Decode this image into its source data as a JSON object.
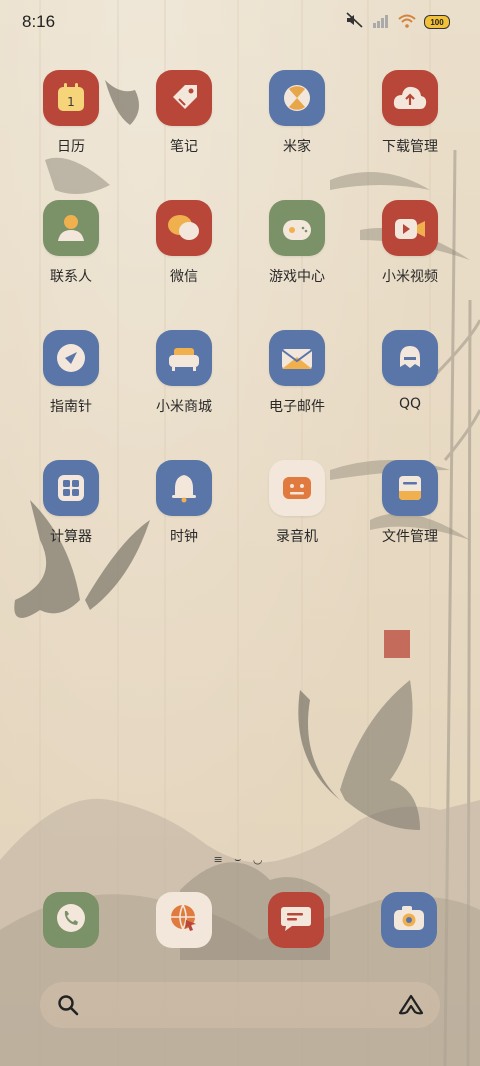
{
  "status_bar": {
    "time": "8:16",
    "battery_level": "100"
  },
  "apps": [
    {
      "label": "日历",
      "icon": "calendar-icon",
      "color": "#b8473a",
      "badge": "1"
    },
    {
      "label": "笔记",
      "icon": "tag-icon",
      "color": "#b8473a"
    },
    {
      "label": "米家",
      "icon": "mijia-icon",
      "color": "#5a76a8"
    },
    {
      "label": "下载管理",
      "icon": "cloud-upload-icon",
      "color": "#b8473a"
    },
    {
      "label": "联系人",
      "icon": "contact-icon",
      "color": "#7b9168"
    },
    {
      "label": "微信",
      "icon": "chat-bubble-icon",
      "color": "#b8473a"
    },
    {
      "label": "游戏中心",
      "icon": "gamepad-icon",
      "color": "#7b9168"
    },
    {
      "label": "小米视频",
      "icon": "video-camera-icon",
      "color": "#b8473a"
    },
    {
      "label": "指南针",
      "icon": "compass-icon",
      "color": "#5a76a8"
    },
    {
      "label": "小米商城",
      "icon": "sofa-icon",
      "color": "#5a76a8"
    },
    {
      "label": "电子邮件",
      "icon": "mail-icon",
      "color": "#5a76a8"
    },
    {
      "label": "QQ",
      "icon": "penguin-icon",
      "color": "#5a76a8"
    },
    {
      "label": "计算器",
      "icon": "calculator-icon",
      "color": "#5a76a8"
    },
    {
      "label": "时钟",
      "icon": "bell-icon",
      "color": "#5a76a8"
    },
    {
      "label": "录音机",
      "icon": "recorder-icon",
      "color": "#f3e7db"
    },
    {
      "label": "文件管理",
      "icon": "file-icon",
      "color": "#5a76a8"
    }
  ],
  "page_indicator": "≡ ⌣ ◡",
  "dock": [
    {
      "name": "phone",
      "icon": "phone-icon",
      "color": "#7b9168"
    },
    {
      "name": "browser",
      "icon": "globe-icon",
      "color": "#f3e7db"
    },
    {
      "name": "messages",
      "icon": "message-icon",
      "color": "#b8473a"
    },
    {
      "name": "camera",
      "icon": "camera-icon",
      "color": "#5a76a8"
    }
  ],
  "search": {
    "placeholder": "",
    "left_icon": "search-icon",
    "right_icon": "assistant-icon"
  }
}
